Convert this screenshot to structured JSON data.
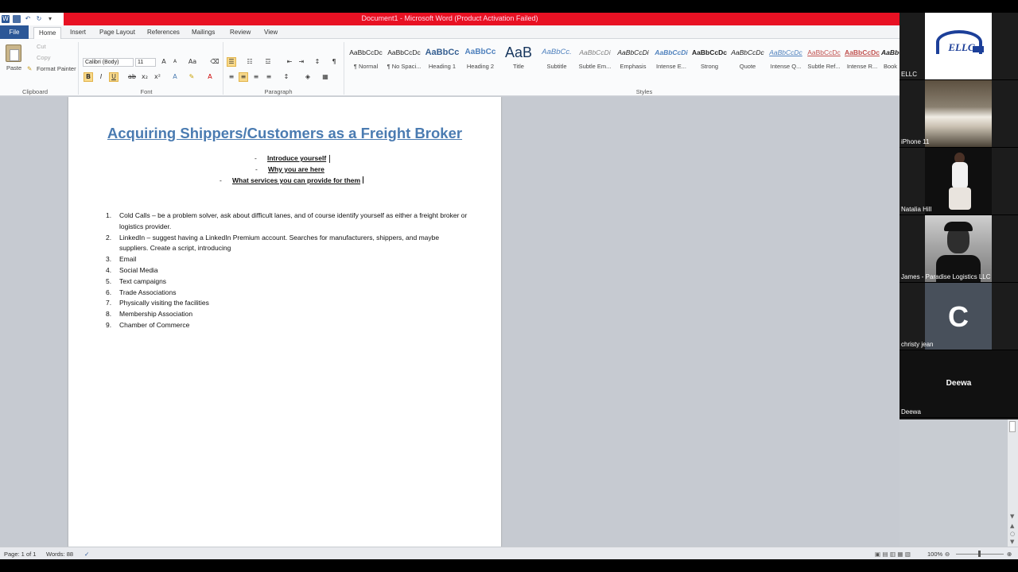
{
  "window": {
    "title": "Document1 - Microsoft Word (Product Activation Failed)"
  },
  "tabs": [
    "File",
    "Home",
    "Insert",
    "Page Layout",
    "References",
    "Mailings",
    "Review",
    "View"
  ],
  "ribbon": {
    "clipboard": {
      "paste": "Paste",
      "cut": "Cut",
      "copy": "Copy",
      "format_painter": "Format Painter",
      "label": "Clipboard"
    },
    "font": {
      "name": "Calibri (Body)",
      "size": "11",
      "label": "Font"
    },
    "paragraph": {
      "label": "Paragraph"
    },
    "styles": {
      "label": "Styles",
      "items": [
        {
          "sample": "AaBbCcDc",
          "name": "¶ Normal"
        },
        {
          "sample": "AaBbCcDc",
          "name": "¶ No Spaci..."
        },
        {
          "sample": "AaBbCc",
          "name": "Heading 1"
        },
        {
          "sample": "AaBbCc",
          "name": "Heading 2"
        },
        {
          "sample": "AaB",
          "name": "Title"
        },
        {
          "sample": "AaBbCc.",
          "name": "Subtitle"
        },
        {
          "sample": "AaBbCcDi",
          "name": "Subtle Em..."
        },
        {
          "sample": "AaBbCcDi",
          "name": "Emphasis"
        },
        {
          "sample": "AaBbCcDi",
          "name": "Intense E..."
        },
        {
          "sample": "AaBbCcDc",
          "name": "Strong"
        },
        {
          "sample": "AaBbCcDc",
          "name": "Quote"
        },
        {
          "sample": "AaBbCcDc",
          "name": "Intense Q..."
        },
        {
          "sample": "AaBbCcDc",
          "name": "Subtle Ref..."
        },
        {
          "sample": "AaBbCcDc",
          "name": "Intense R..."
        },
        {
          "sample": "AaBbCcDc",
          "name": "Book"
        }
      ]
    }
  },
  "document": {
    "title": "Acquiring Shippers/Customers as a Freight Broker",
    "bullets": [
      "Introduce yourself",
      "Why you are here",
      "What services you can provide for them"
    ],
    "list": [
      {
        "num": "1.",
        "text": "Cold Calls – be a problem solver, ask about difficult lanes, and of course identify yourself as either a freight broker or logistics provider."
      },
      {
        "num": "2.",
        "text": "LinkedIn – suggest having a LinkedIn Premium account.  Searches for manufacturers, shippers, and maybe suppliers.  Create a script, introducing"
      },
      {
        "num": "3.",
        "text": "Email"
      },
      {
        "num": "4.",
        "text": "Social Media"
      },
      {
        "num": "5.",
        "text": "Text campaigns"
      },
      {
        "num": "6.",
        "text": "Trade Associations"
      },
      {
        "num": "7.",
        "text": "Physically visiting the facilities"
      },
      {
        "num": "8.",
        "text": "Membership Association"
      },
      {
        "num": "9.",
        "text": "Chamber of Commerce"
      }
    ]
  },
  "statusbar": {
    "page": "Page: 1 of 1",
    "words": "Words: 88",
    "zoom": "100%"
  },
  "participants": [
    {
      "name": "ELLC",
      "logo_text": "ELLC"
    },
    {
      "name": "iPhone 11"
    },
    {
      "name": "Natalia Hill"
    },
    {
      "name": "James - Paradise Logistics LLC"
    },
    {
      "name": "christy jean",
      "initial": "C"
    },
    {
      "name": "Deewa",
      "center_label": "Deewa"
    }
  ]
}
